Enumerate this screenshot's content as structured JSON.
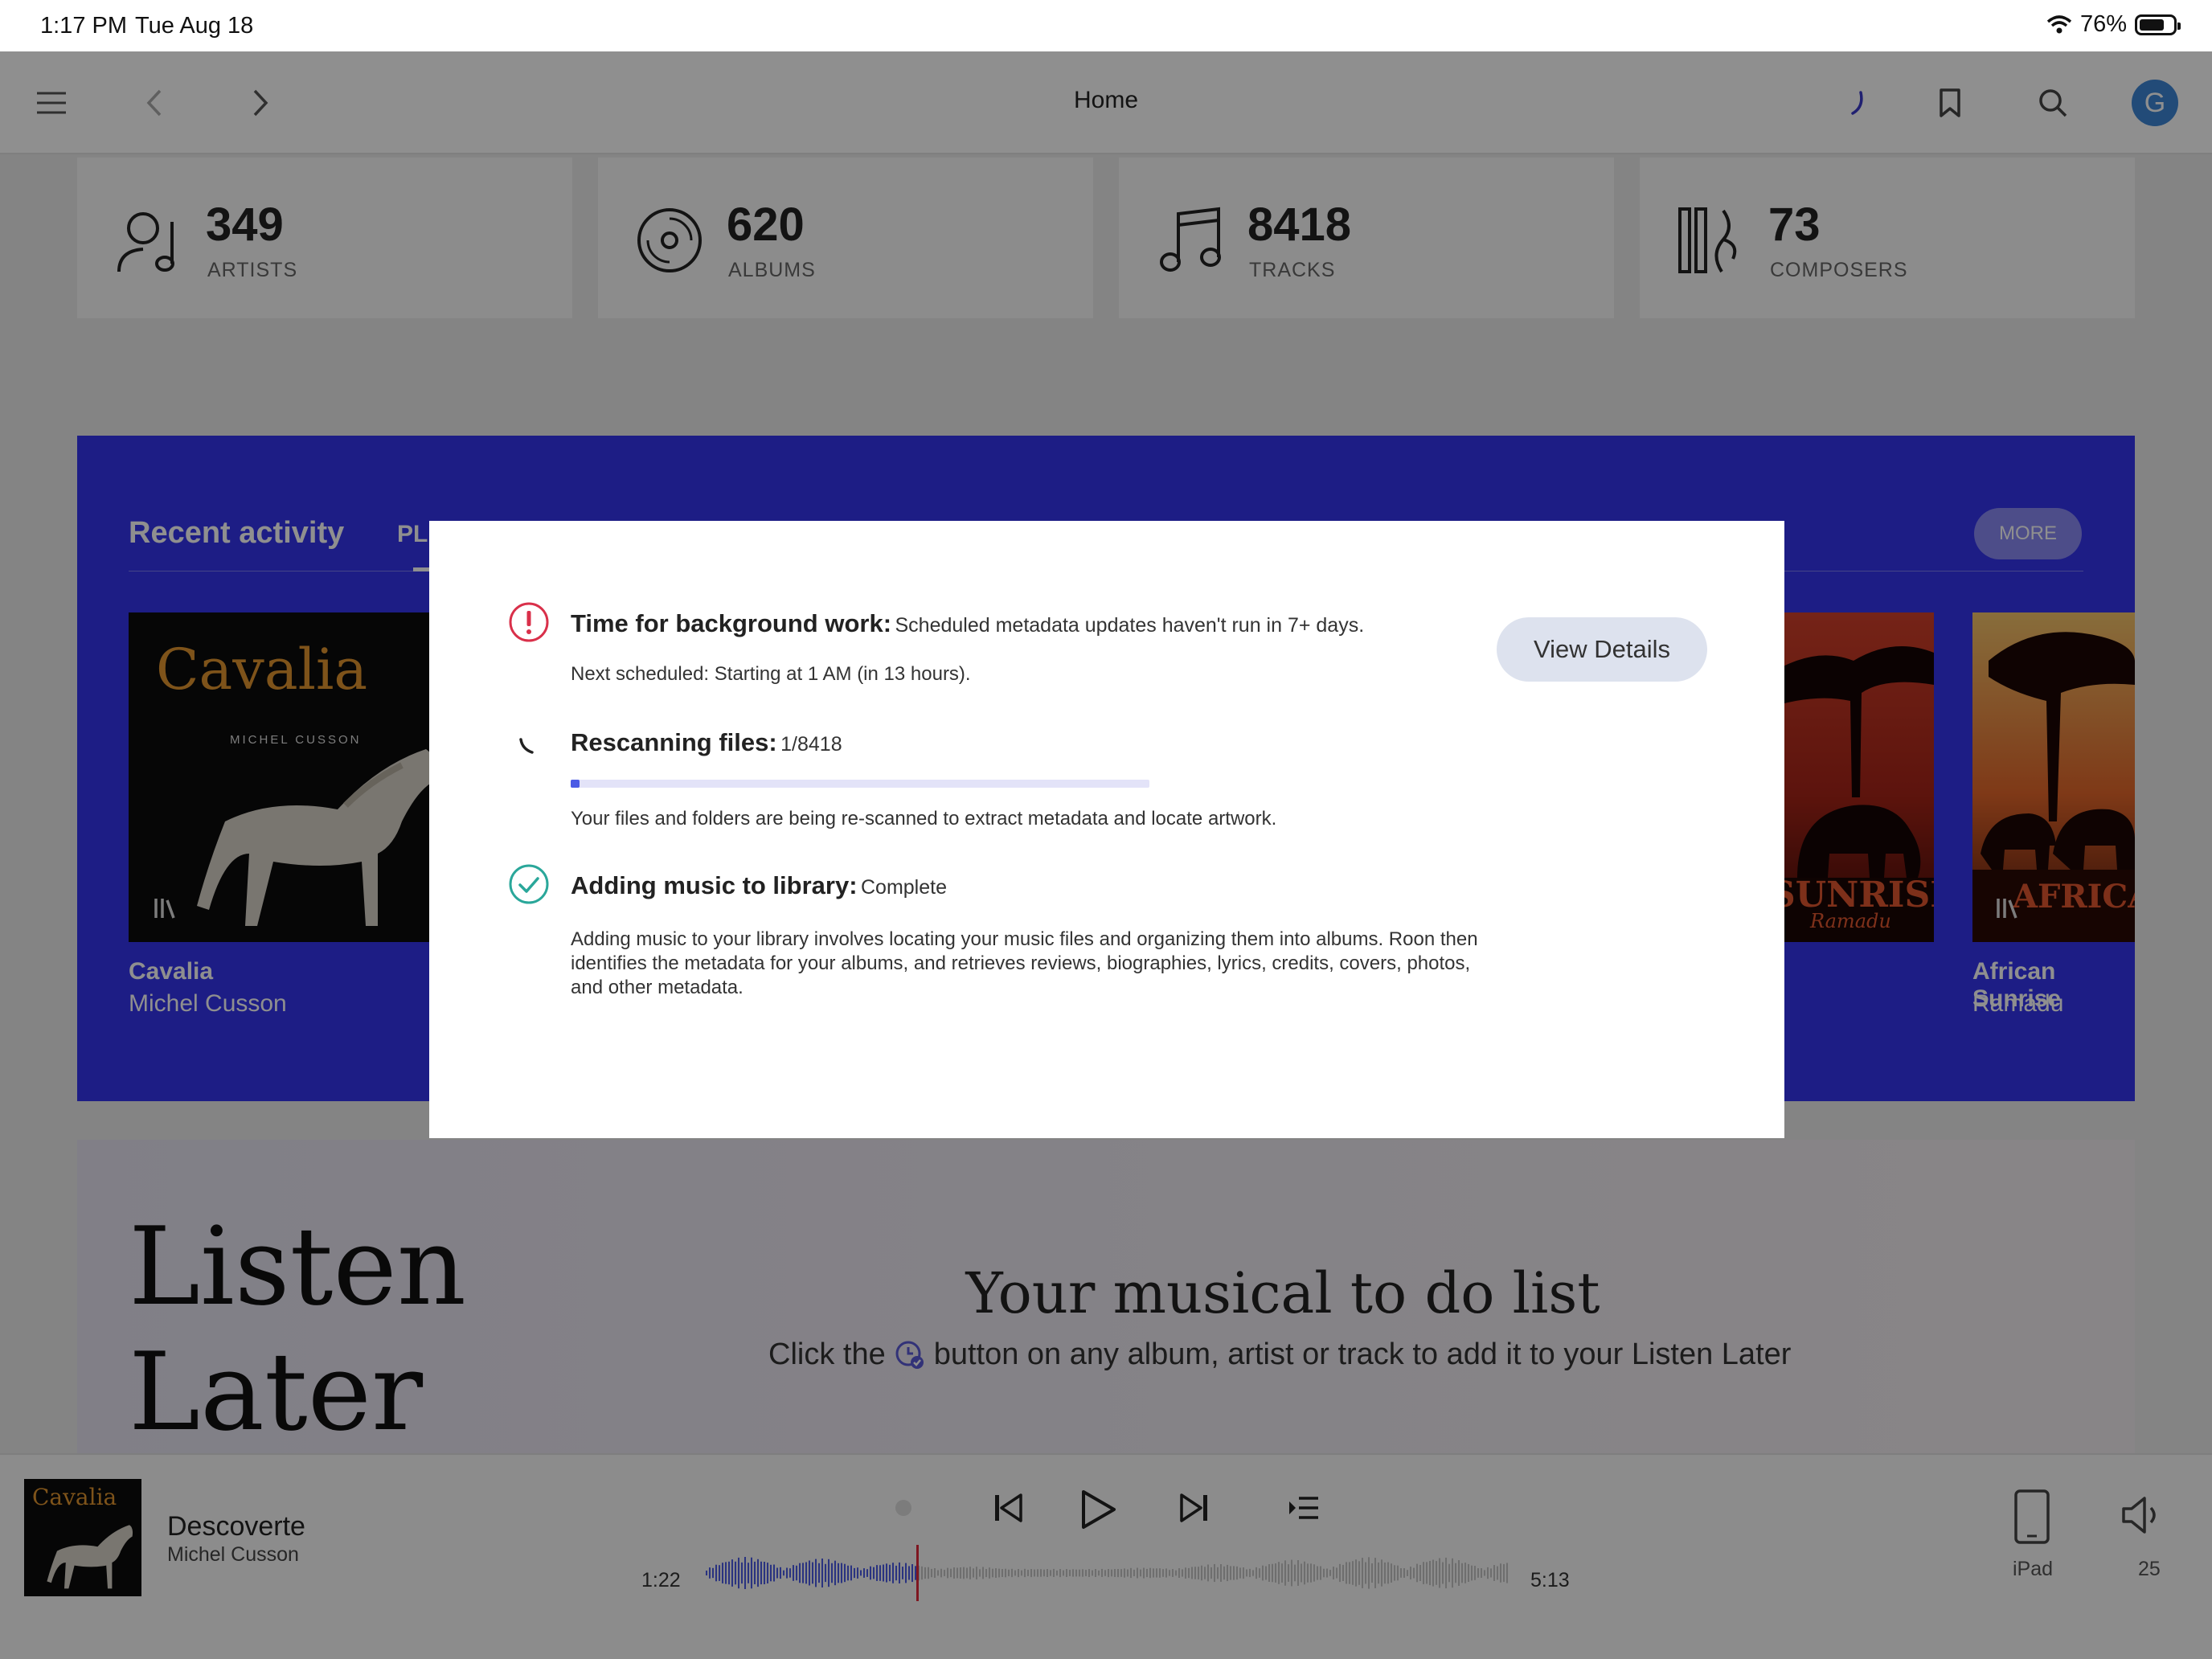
{
  "status_bar": {
    "time": "1:17 PM",
    "date": "Tue Aug 18",
    "battery": "76%",
    "battery_level": 0.76
  },
  "header": {
    "title": "Home"
  },
  "stats": [
    {
      "value": "349",
      "label": "ARTISTS",
      "icon": "artist-icon"
    },
    {
      "value": "620",
      "label": "ALBUMS",
      "icon": "album-icon"
    },
    {
      "value": "8418",
      "label": "TRACKS",
      "icon": "music-note-icon"
    },
    {
      "value": "73",
      "label": "COMPOSERS",
      "icon": "composer-icon"
    }
  ],
  "recent": {
    "title": "Recent activity",
    "tab2": "PL",
    "more": "MORE",
    "items": [
      {
        "title": "Cavalia",
        "artist": "Michel Cusson",
        "cover_title": "Cavalia",
        "cover_credit": "MICHEL CUSSON"
      },
      {
        "title": "African Sunrise",
        "artist": "Ramadu",
        "cover_title": "AFRICAN",
        "cover_partial": "SUNRISE",
        "cover_sub": "Ramadu"
      }
    ]
  },
  "listen_later": {
    "title_line1": "Listen",
    "title_line2": "Later",
    "heading": "Your musical to do list",
    "text_before": "Click the",
    "text_after": "button on any album, artist or track to add it to your Listen Later"
  },
  "player": {
    "track": "Descoverte",
    "artist": "Michel Cusson",
    "elapsed": "1:22",
    "duration": "5:13",
    "progress": 0.262,
    "device": "iPad",
    "volume": "25"
  },
  "modal": {
    "bg_work_title": "Time for background work:",
    "bg_work_detail": "Scheduled metadata updates haven't run in 7+ days.",
    "bg_work_next": "Next scheduled: Starting at 1 AM (in 13 hours).",
    "view_details": "View Details",
    "rescan_title": "Rescanning files:",
    "rescan_count": "1/8418",
    "rescan_progress": 0.012,
    "rescan_text": "Your files and folders are being re-scanned to extract metadata and locate artwork.",
    "adding_title": "Adding music to library:",
    "adding_status": "Complete",
    "adding_text": "Adding music to your library involves locating your music files and organizing them into albums. Roon then identifies the metadata for your albums, and retrieves reviews, biographies, lyrics, credits, covers, photos, and other metadata."
  },
  "colors": {
    "accent": "#3535ee",
    "error": "#d9304a",
    "success": "#2aa79a",
    "progress": "#4b5be5"
  }
}
